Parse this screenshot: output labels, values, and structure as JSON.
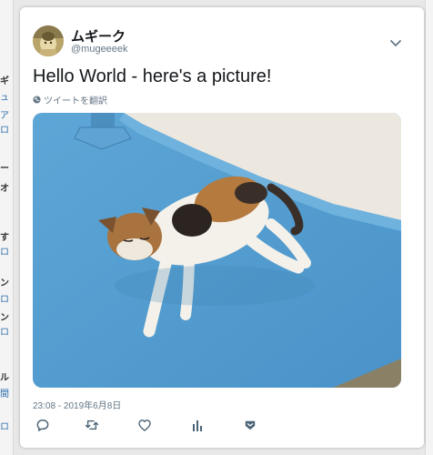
{
  "tweet": {
    "display_name": "ムギーク",
    "handle": "@mugeeeek",
    "text": "Hello World - here's a picture!",
    "translate_label": "ツイートを翻訳",
    "timestamp": "23:08 - 2019年6月8日"
  },
  "background_fragments": [
    "ギ",
    "ュ",
    "ア",
    "ロ",
    "ー",
    "オ",
    "す",
    "ロ",
    "ン",
    "ロ",
    "ン",
    "ロ",
    "ル",
    "間",
    "ロ"
  ],
  "colors": {
    "accent": "#1da1f2",
    "text": "#14171a",
    "secondary_text": "#657786",
    "icon": "#4a6376"
  },
  "icons": {
    "more": "chevron-down-icon",
    "translate": "globe-icon",
    "reply": "reply-icon",
    "retweet": "retweet-icon",
    "like": "heart-icon",
    "analytics": "analytics-icon",
    "dm": "share-icon"
  }
}
